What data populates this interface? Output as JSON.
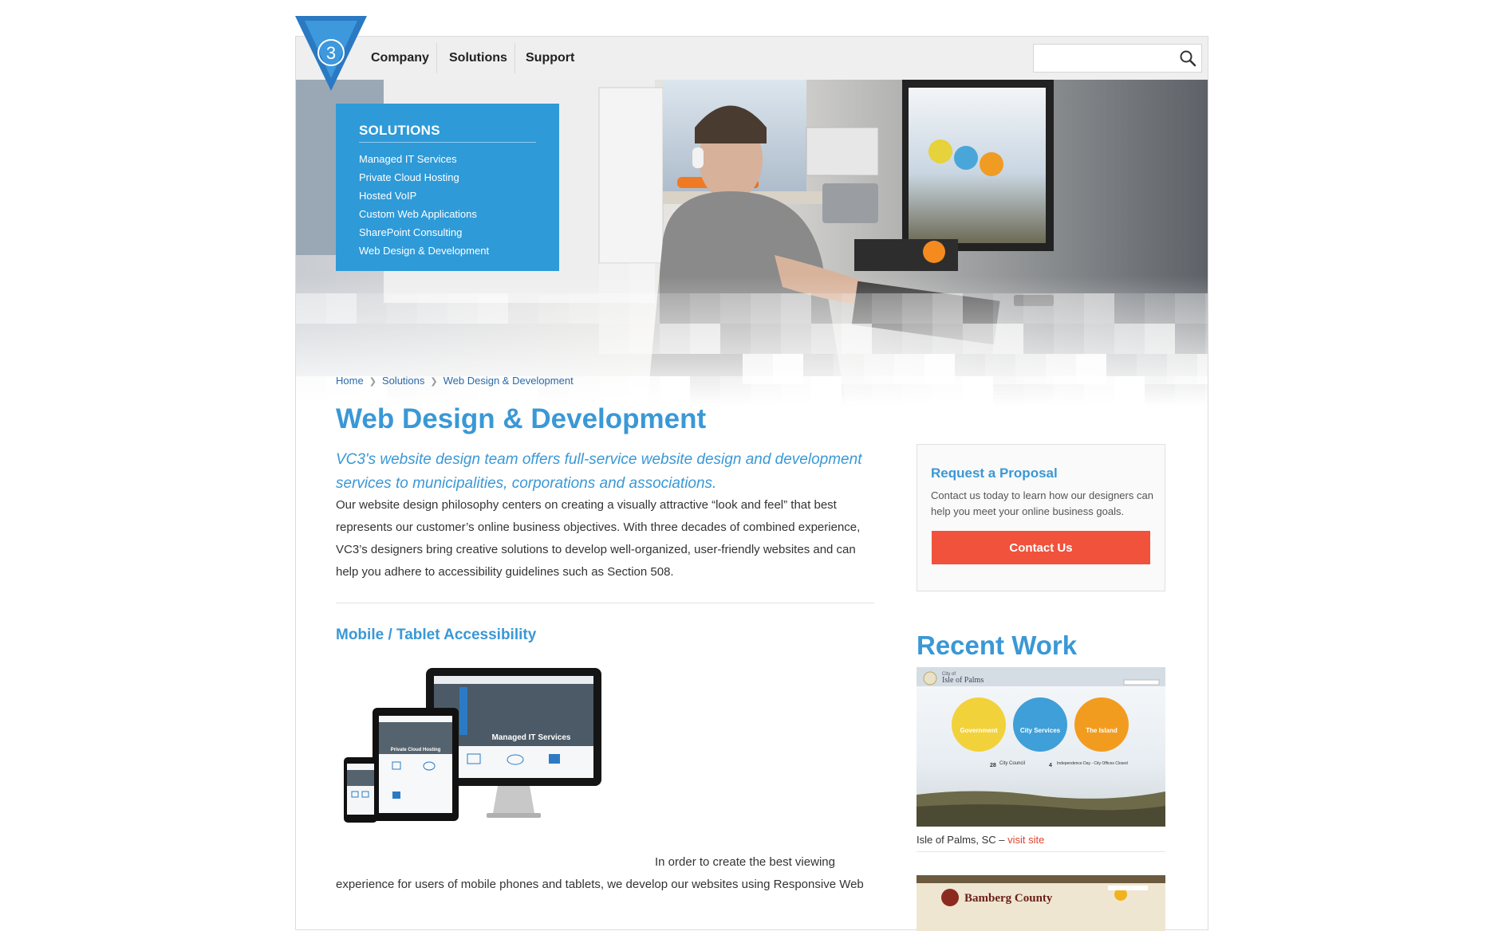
{
  "nav": {
    "items": [
      "Company",
      "Solutions",
      "Support"
    ],
    "search_placeholder": ""
  },
  "solutions_panel": {
    "heading": "SOLUTIONS",
    "items": [
      "Managed IT Services",
      "Private Cloud Hosting",
      "Hosted VoIP",
      "Custom Web Applications",
      "SharePoint Consulting",
      "Web Design & Development"
    ]
  },
  "breadcrumb": [
    "Home",
    "Solutions",
    "Web Design & Development"
  ],
  "main": {
    "title": "Web Design & Development",
    "intro": "VC3's website design team offers full-service website design and development services to municipalities, corporations and associations.",
    "body": "Our website design philosophy centers on creating a visually attractive “look and feel” that best represents our customer’s online business objectives. With three decades of combined experience, VC3’s designers bring creative solutions to develop well-organized, user-friendly websites and can help you adhere to accessibility guidelines such as Section 508.",
    "section_heading": "Mobile / Tablet Accessibility",
    "section_text_1": "In order to create the best viewing",
    "section_text_2": "experience for users of mobile phones and tablets, we develop our websites using Responsive Web"
  },
  "devices_mockup": {
    "desktop_banner": "Managed IT Services",
    "tablet_banner": "Private Cloud Hosting"
  },
  "sidebar": {
    "proposal": {
      "title": "Request a Proposal",
      "text": "Contact us today to learn how our designers can help you meet your online business goals.",
      "button": "Contact Us"
    },
    "recent_work": {
      "title": "Recent Work",
      "items": [
        {
          "place": "Isle of Palms, SC – ",
          "link": "visit site",
          "thumb_site_name": "Isle of Palms",
          "thumb_city_of": "City of",
          "thumb_circles": [
            "Government",
            "City Services",
            "The Island"
          ],
          "event_1_day": "28",
          "event_1_title": "City Council",
          "event_2_day": "4",
          "event_2_title": "Independence Day - City Offices Closed"
        },
        {
          "thumb_site_name": "Bamberg County"
        }
      ]
    }
  },
  "colors": {
    "brand_blue": "#3a98d6",
    "panel_blue": "#2e9ad8",
    "cta_red": "#f0523c",
    "link_red": "#e2432e",
    "breadcrumb_blue": "#2a6aa8"
  },
  "icons": [
    "vc3-logo-icon",
    "search-icon",
    "chevron-right-icon"
  ]
}
